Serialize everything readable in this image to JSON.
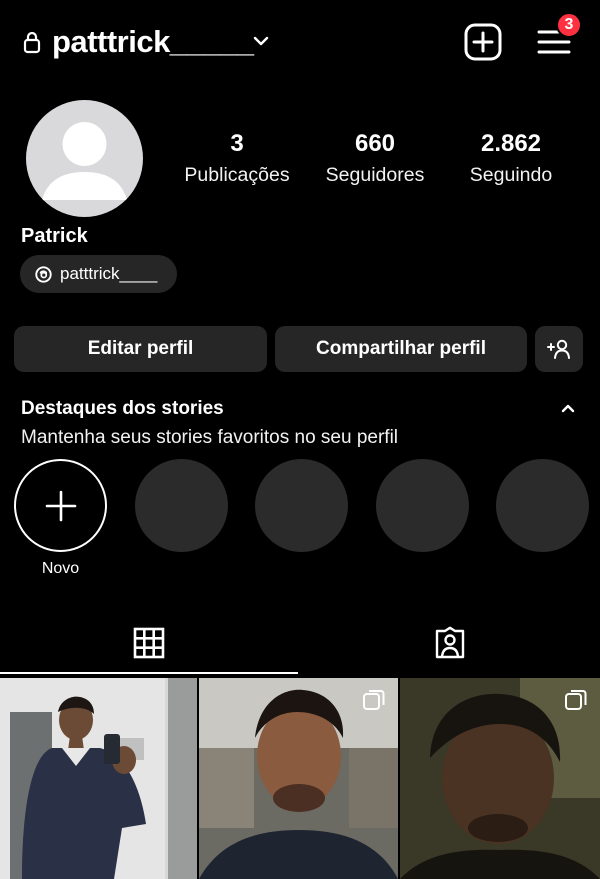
{
  "header": {
    "username": "patttrick_____",
    "notification_count": "3",
    "icons": [
      "lock-icon",
      "chevron-down-icon",
      "new-post-icon",
      "menu-icon"
    ]
  },
  "profile": {
    "name": "Patrick",
    "threads_handle": "patttrick____",
    "stats": [
      {
        "value": "3",
        "label": "Publicações"
      },
      {
        "value": "660",
        "label": "Seguidores"
      },
      {
        "value": "2.862",
        "label": "Seguindo"
      }
    ]
  },
  "actions": {
    "edit": "Editar perfil",
    "share": "Compartilhar perfil"
  },
  "highlights": {
    "title": "Destaques dos stories",
    "subtitle": "Mantenha seus stories favoritos no seu perfil",
    "new_label": "Novo",
    "placeholder_count": 4
  },
  "tabs": [
    {
      "name": "posts-grid",
      "icon": "grid-icon",
      "active": true
    },
    {
      "name": "tagged",
      "icon": "tagged-person-icon",
      "active": false
    }
  ],
  "posts": [
    {
      "type": "single",
      "description": "mirror selfie"
    },
    {
      "type": "carousel",
      "description": "selfie"
    },
    {
      "type": "carousel",
      "description": "selfie"
    }
  ],
  "colors": {
    "background": "#000000",
    "button": "#262626",
    "badge": "#ff3040",
    "highlight_placeholder": "#2b2b2b"
  }
}
